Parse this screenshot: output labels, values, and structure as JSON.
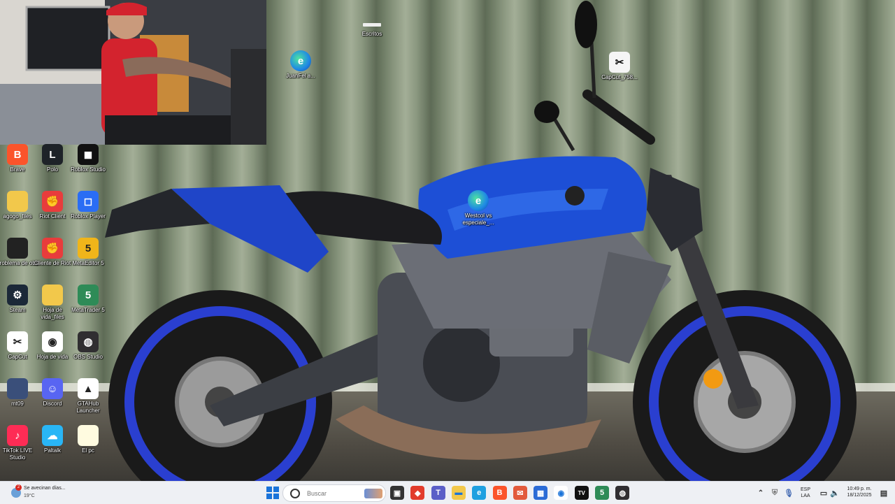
{
  "screen": {
    "desktop_icons": [
      {
        "label": "Brave",
        "icon": "brave-icon",
        "color": "#fb542b",
        "glyph": "B"
      },
      {
        "label": "Polo",
        "icon": "league-icon",
        "color": "#1e2328",
        "glyph": "L"
      },
      {
        "label": "Roblox Studio",
        "icon": "roblox-studio-icon",
        "color": "#111111",
        "glyph": "◼"
      },
      {
        "label": "agogo_files",
        "icon": "folder-icon",
        "color": "#f2c84b",
        "glyph": ""
      },
      {
        "label": "Riot Client",
        "icon": "riot-icon",
        "color": "#e83c3c",
        "glyph": "✊"
      },
      {
        "label": "Roblox Player",
        "icon": "roblox-icon",
        "color": "#2a6df4",
        "glyph": "◻"
      },
      {
        "label": "problema de obs",
        "icon": "file-icon",
        "color": "#222222",
        "glyph": ""
      },
      {
        "label": "Cliente de Riot",
        "icon": "riot-icon",
        "color": "#e83c3c",
        "glyph": "✊"
      },
      {
        "label": "MetaEditor 5",
        "icon": "metaeditor-icon",
        "color": "#f0b51a",
        "glyph": "5"
      },
      {
        "label": "Steam",
        "icon": "steam-icon",
        "color": "#1b2838",
        "glyph": "⚙"
      },
      {
        "label": "Hoja de vida_files",
        "icon": "folder-icon",
        "color": "#f2c84b",
        "glyph": ""
      },
      {
        "label": "MetaTrader 5",
        "icon": "metatrader-icon",
        "color": "#2e8b57",
        "glyph": "5"
      },
      {
        "label": "CapCut",
        "icon": "capcut-icon",
        "color": "#ffffff",
        "glyph": "✂"
      },
      {
        "label": "Hoja de vida",
        "icon": "chrome-icon",
        "color": "#ffffff",
        "glyph": "◉"
      },
      {
        "label": "OBS Studio",
        "icon": "obs-icon",
        "color": "#302e31",
        "glyph": "◍"
      },
      {
        "label": "mt09",
        "icon": "image-icon",
        "color": "#3a4f7a",
        "glyph": ""
      },
      {
        "label": "Discord",
        "icon": "discord-icon",
        "color": "#5865f2",
        "glyph": "☺"
      },
      {
        "label": "GTAHub Launcher",
        "icon": "gtahub-icon",
        "color": "#ffffff",
        "glyph": "▲"
      },
      {
        "label": "TikTok LIVE Studio",
        "icon": "tiktok-icon",
        "color": "#fe2c55",
        "glyph": "♪"
      },
      {
        "label": "Paltalk",
        "icon": "paltalk-icon",
        "color": "#29b6f6",
        "glyph": "☁"
      },
      {
        "label": "El pc",
        "icon": "text-file-icon",
        "color": "#fffbe0",
        "glyph": ""
      }
    ],
    "floating_icons": [
      {
        "label": "Escritos",
        "icon": "file-icon"
      },
      {
        "label": "JuanFel a...",
        "icon": "edge-icon"
      },
      {
        "label": "CapCut_758...",
        "icon": "capcut-file-icon"
      },
      {
        "label": "Westcol vs especiale_...",
        "icon": "edge-icon"
      }
    ],
    "taskbar": {
      "weather_badge": "2",
      "weather_text": "Se avecinan días...",
      "temperature": "19°C",
      "search_placeholder": "Buscar",
      "language": "ESP",
      "language_sub": "LAA",
      "time": "10:49 p. m.",
      "date": "18/12/2025",
      "apps": [
        {
          "name": "task-view-icon",
          "color": "#333333",
          "glyph": "▣"
        },
        {
          "name": "anydesk-icon",
          "color": "#e23c2c",
          "glyph": "◆"
        },
        {
          "name": "teams-icon",
          "color": "#5b5fc7",
          "glyph": "T"
        },
        {
          "name": "file-explorer-icon",
          "color": "#f2c84b",
          "glyph": "▬"
        },
        {
          "name": "edge-icon",
          "color": "#1fa0e0",
          "glyph": "e"
        },
        {
          "name": "brave-icon",
          "color": "#fb542b",
          "glyph": "B"
        },
        {
          "name": "mail-icon",
          "color": "#e25a3c",
          "glyph": "✉"
        },
        {
          "name": "store-icon",
          "color": "#2b6bd6",
          "glyph": "▦"
        },
        {
          "name": "chrome-icon",
          "color": "#ffffff",
          "glyph": "◉"
        },
        {
          "name": "tradingview-icon",
          "color": "#111111",
          "glyph": "TV"
        },
        {
          "name": "metatrader-icon",
          "color": "#2e8b57",
          "glyph": "5"
        },
        {
          "name": "obs-icon",
          "color": "#302e31",
          "glyph": "◍"
        }
      ]
    }
  }
}
